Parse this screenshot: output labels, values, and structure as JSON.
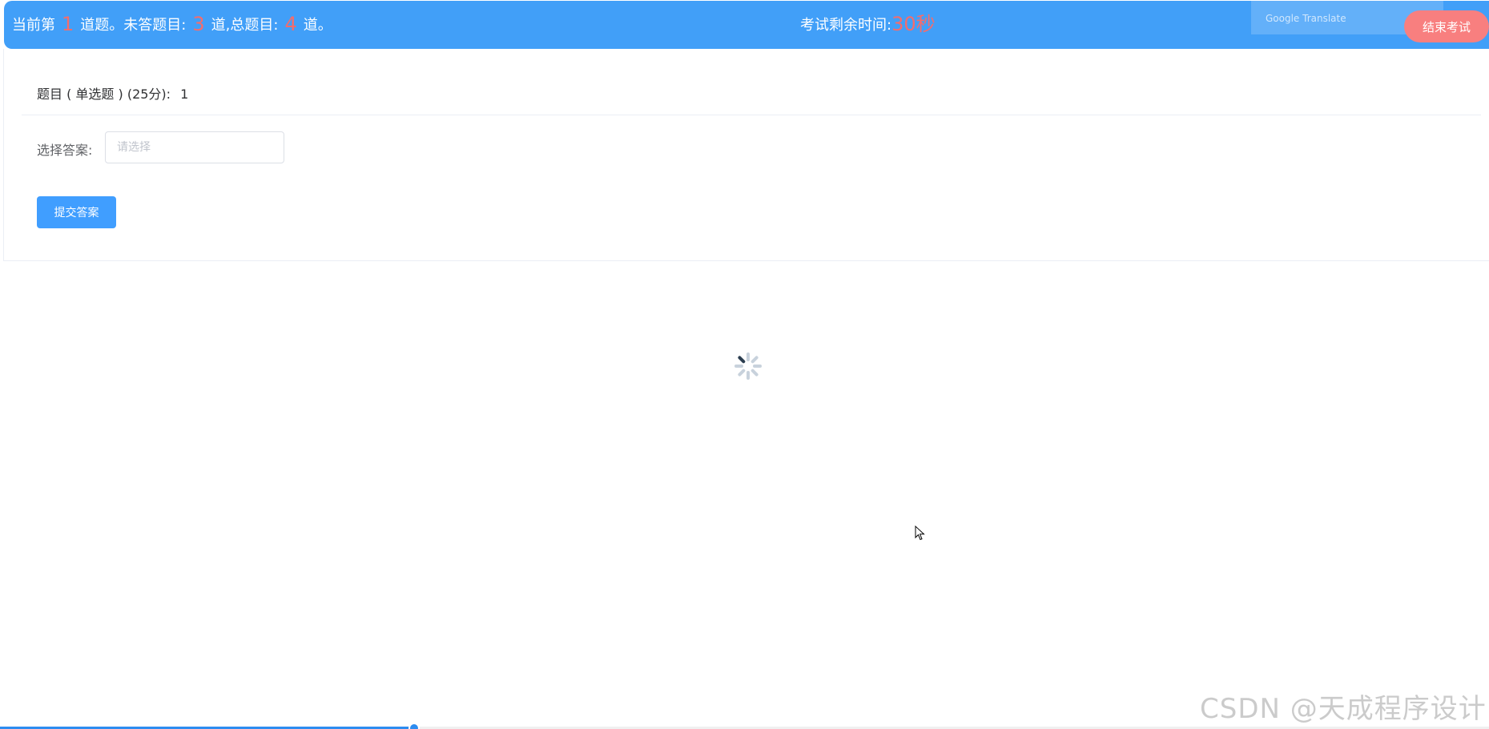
{
  "header": {
    "current_prefix": "当前第",
    "current_num": "1",
    "current_suffix": "道题。未答题目:",
    "unanswered_num": "3",
    "unanswered_suffix": "道,总题目:",
    "total_num": "4",
    "total_suffix": "道。",
    "time_label": "考试剩余时间:",
    "time_value": "30秒",
    "end_button": "结束考试",
    "translate_overlay": "Google Translate"
  },
  "question": {
    "title": "题目 ( 单选题 ) (25分):",
    "number": "1",
    "answer_label": "选择答案:",
    "answer_placeholder": "请选择",
    "submit_label": "提交答案"
  },
  "watermark": "CSDN @天成程序设计",
  "video_progress": 0.28,
  "colors": {
    "header_bg": "#419ff8",
    "highlight": "#f56c6c",
    "primary": "#409eff",
    "end_button": "#f87f7f"
  },
  "icons": {
    "spinner": "loading-spinner-icon",
    "cursor": "mouse-pointer-icon"
  }
}
